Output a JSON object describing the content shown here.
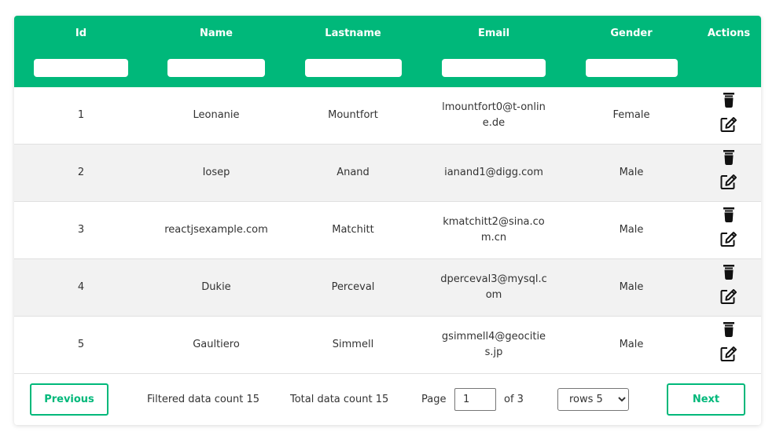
{
  "table": {
    "columns": [
      {
        "key": "id",
        "label": "Id",
        "filter": true
      },
      {
        "key": "name",
        "label": "Name",
        "filter": true
      },
      {
        "key": "lastname",
        "label": "Lastname",
        "filter": true
      },
      {
        "key": "email",
        "label": "Email",
        "filter": true
      },
      {
        "key": "gender",
        "label": "Gender",
        "filter": true
      },
      {
        "key": "actions",
        "label": "Actions",
        "filter": false
      }
    ],
    "rows": [
      {
        "id": "1",
        "name": "Leonanie",
        "lastname": "Mountfort",
        "email": "lmountfort0@t-online.de",
        "gender": "Female"
      },
      {
        "id": "2",
        "name": "Iosep",
        "lastname": "Anand",
        "email": "ianand1@digg.com",
        "gender": "Male"
      },
      {
        "id": "3",
        "name": "reactjsexample.com",
        "lastname": "Matchitt",
        "email": "kmatchitt2@sina.com.cn",
        "gender": "Male"
      },
      {
        "id": "4",
        "name": "Dukie",
        "lastname": "Perceval",
        "email": "dperceval3@mysql.com",
        "gender": "Male"
      },
      {
        "id": "5",
        "name": "Gaultiero",
        "lastname": "Simmell",
        "email": "gsimmell4@geocities.jp",
        "gender": "Male"
      }
    ],
    "action_icons": [
      "trash-icon",
      "edit-icon"
    ]
  },
  "footer": {
    "previous_label": "Previous",
    "filtered_count_text": "Filtered data count 15",
    "total_count_text": "Total data count 15",
    "page_label": "Page",
    "page_value": "1",
    "of_text": "of 3",
    "rows_selected": "rows 5",
    "next_label": "Next"
  },
  "colors": {
    "accent": "#00b87a",
    "row_alt": "#f2f2f2"
  }
}
